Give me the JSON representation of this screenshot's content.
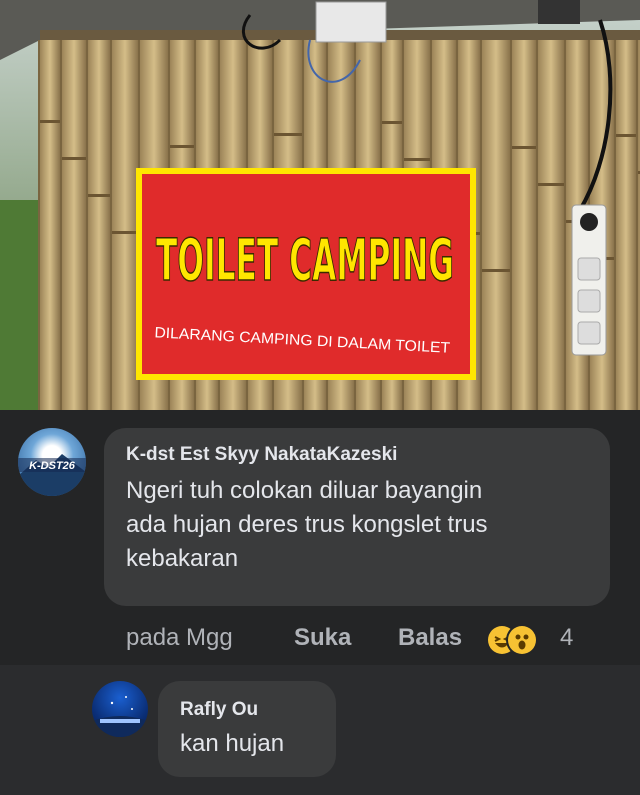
{
  "photo": {
    "sign_title": "TOILET CAMPING",
    "sign_subtitle": "DILARANG CAMPING DI DALAM TOILET"
  },
  "comment1": {
    "avatar_label": "K-DST26",
    "author": "K-dst Est Skyy NakataKazeski",
    "lines": [
      "Ngeri tuh colokan diluar bayangin",
      "ada hujan deres trus kongslet trus",
      "kebakaran"
    ],
    "time": "pada Mgg",
    "like_label": "Suka",
    "reply_label": "Balas",
    "reaction_count": "4",
    "reaction_icons": [
      "haha-icon",
      "wow-icon"
    ]
  },
  "reply1": {
    "author": "Rafly Ou",
    "text": "kan hujan"
  },
  "colors": {
    "background": "#242526",
    "bubble": "#3a3b3c",
    "text": "#e4e6eb",
    "muted": "#b0b3b8",
    "sign_red": "#e02b2b",
    "sign_yellow": "#ffe600"
  }
}
